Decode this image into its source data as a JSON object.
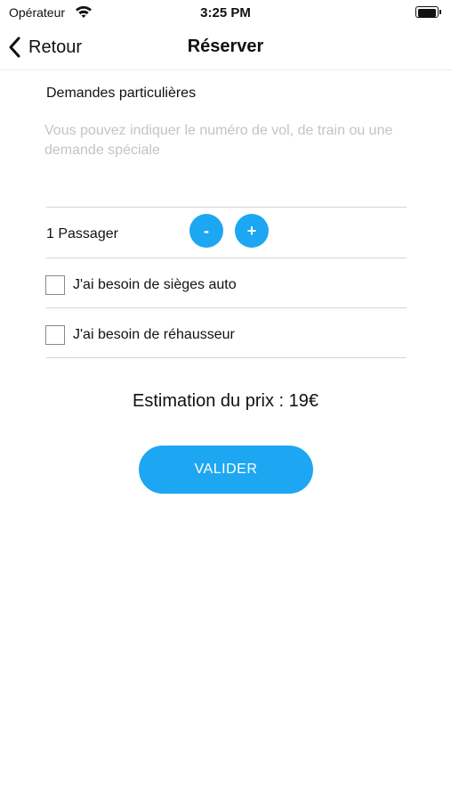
{
  "status_bar": {
    "carrier": "Opérateur",
    "time": "3:25 PM",
    "icons": [
      "wifi-icon",
      "battery-icon"
    ]
  },
  "nav": {
    "back_label": "Retour",
    "back_icon": "chevron-left-icon",
    "title": "Réserver"
  },
  "requests": {
    "label": "Demandes particulières",
    "value": "",
    "placeholder": "Vous pouvez indiquer le numéro de vol, de train ou une demande spéciale"
  },
  "passengers": {
    "label": "1 Passager",
    "decrement_label": "-",
    "increment_label": "+"
  },
  "options": [
    {
      "label": "J'ai besoin de sièges auto",
      "checked": false
    },
    {
      "label": "J'ai besoin de réhausseur",
      "checked": false
    }
  ],
  "price": {
    "estimate": "Estimation du prix : 19€"
  },
  "actions": {
    "submit_label": "VALIDER"
  },
  "colors": {
    "accent": "#1da7f2",
    "placeholder": "#c4c4c8",
    "divider": "#d5d5d5"
  }
}
